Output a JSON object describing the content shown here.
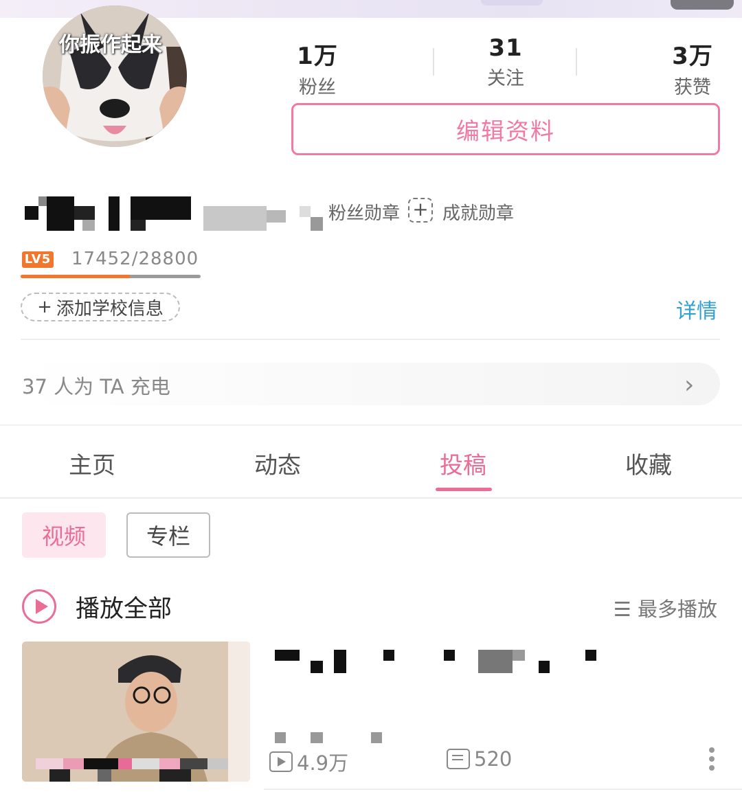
{
  "avatar": {
    "caption": "你振作起来"
  },
  "stats": [
    {
      "value": "1万",
      "label": "粉丝"
    },
    {
      "value": "31",
      "label": "关注"
    },
    {
      "value": "3万",
      "label": "获赞"
    }
  ],
  "profile": {
    "edit_label": "编辑资料",
    "fan_badge_label": "粉丝勋章",
    "achievement_badge_label": "成就勋章",
    "level_badge": "LV5",
    "exp_text": "17452/28800",
    "exp_progress": 0.606,
    "add_school_label": "添加学校信息",
    "detail_label": "详情",
    "charge_text": "37 人为 TA 充电"
  },
  "tabs": [
    {
      "label": "主页",
      "active": false
    },
    {
      "label": "动态",
      "active": false
    },
    {
      "label": "投稿",
      "active": true
    },
    {
      "label": "收藏",
      "active": false
    }
  ],
  "content_types": [
    {
      "label": "视频",
      "active": true
    },
    {
      "label": "专栏",
      "active": false
    }
  ],
  "list_header": {
    "play_all": "播放全部",
    "sort": "最多播放"
  },
  "video": {
    "views": "4.9万",
    "comments": "520"
  },
  "colors": {
    "accent": "#ea6d96",
    "link": "#2fa1d6",
    "level": "#f0772d"
  },
  "icons": [
    "play-circle-icon",
    "sort-icon",
    "add-badge-icon",
    "chevron-right-icon",
    "view-count-icon",
    "comment-icon",
    "more-icon"
  ]
}
